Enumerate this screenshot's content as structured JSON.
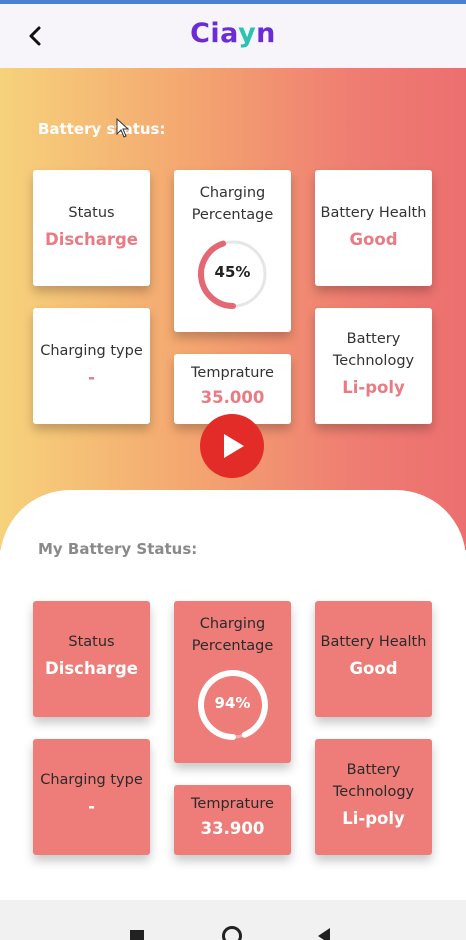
{
  "header": {
    "logo_part1": "Cia",
    "logo_part2": "y",
    "logo_part3": "n"
  },
  "battery_status": {
    "title": "Battery status:",
    "status_label": "Status",
    "status_value": "Discharge",
    "charging_label": "Charging Percentage",
    "charging_value": "45%",
    "charging_level": 0.45,
    "health_label": "Battery Health",
    "health_value": "Good",
    "type_label": "Charging type",
    "type_value": "-",
    "temp_label": "Temprature",
    "temp_value": "35.000",
    "tech_label": "Battery Technology",
    "tech_value": "Li-poly"
  },
  "my_battery_status": {
    "title": "My Battery Status:",
    "status_label": "Status",
    "status_value": "Discharge",
    "charging_label": "Charging Percentage",
    "charging_value": "94%",
    "charging_level": 0.94,
    "health_label": "Battery Health",
    "health_value": "Good",
    "type_label": "Charging type",
    "type_value": "-",
    "temp_label": "Temprature",
    "temp_value": "33.900",
    "tech_label": "Battery Technology",
    "tech_value": "Li-poly"
  },
  "colors": {
    "accent": "#ee7c78",
    "value_text": "#e97b83",
    "logo_purple": "#6b2bd6",
    "logo_teal": "#2ac2b0",
    "play_red": "#e32b27"
  },
  "icons": {
    "back": "back-arrow-icon",
    "play": "play-icon",
    "cursor": "mouse-cursor-icon"
  }
}
